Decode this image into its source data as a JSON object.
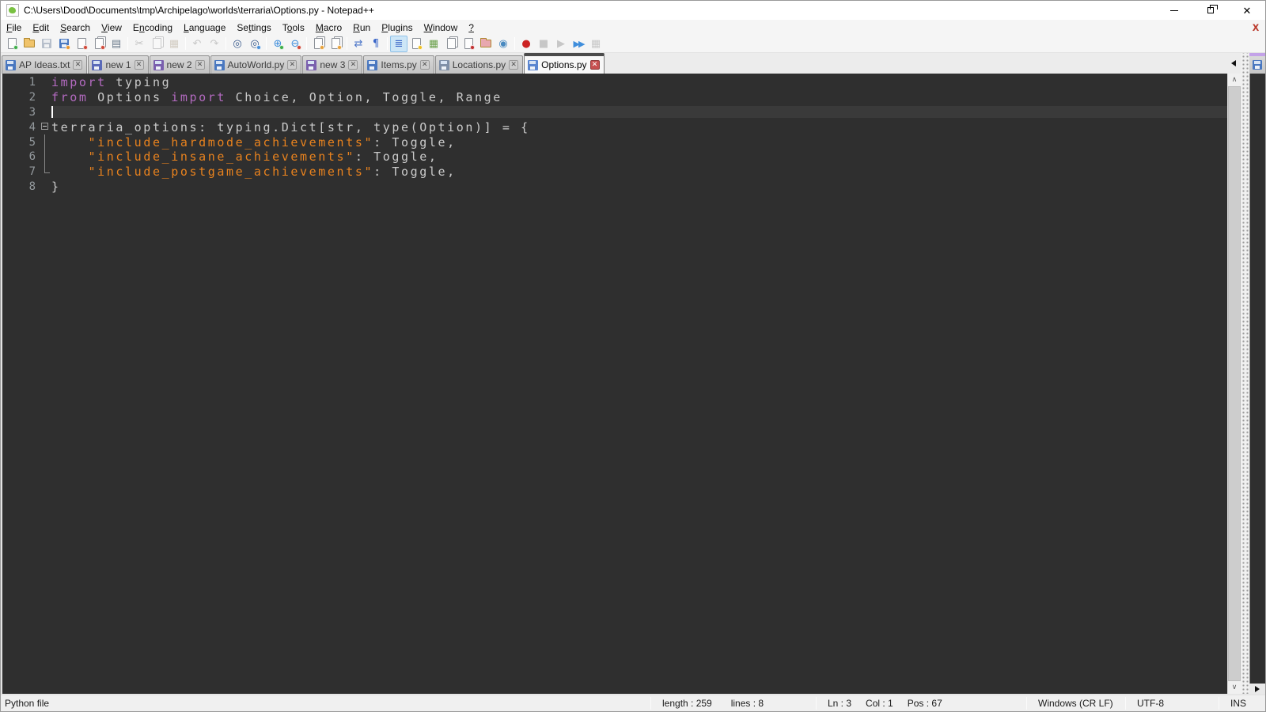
{
  "window": {
    "title": "C:\\Users\\Dood\\Documents\\tmp\\Archipelago\\worlds\\terraria\\Options.py - Notepad++",
    "close_document_label": "X"
  },
  "menu": {
    "items": [
      {
        "label": "File",
        "u": 0
      },
      {
        "label": "Edit",
        "u": 0
      },
      {
        "label": "Search",
        "u": 0
      },
      {
        "label": "View",
        "u": 0
      },
      {
        "label": "Encoding",
        "u": 1
      },
      {
        "label": "Language",
        "u": 0
      },
      {
        "label": "Settings",
        "u": 2
      },
      {
        "label": "Tools",
        "u": 1
      },
      {
        "label": "Macro",
        "u": 0
      },
      {
        "label": "Run",
        "u": 0
      },
      {
        "label": "Plugins",
        "u": 0
      },
      {
        "label": "Window",
        "u": 0
      },
      {
        "label": "?",
        "u": 0
      }
    ]
  },
  "toolbar": {
    "groups": [
      [
        {
          "name": "new-file-button",
          "kind": "page",
          "badge": "#3fae49"
        },
        {
          "name": "open-file-button",
          "kind": "folder",
          "color": "#f0c36a"
        },
        {
          "name": "save-button",
          "kind": "floppy",
          "disabled": true
        },
        {
          "name": "save-all-button",
          "kind": "floppy",
          "badge": "#e8962e"
        },
        {
          "name": "close-file-button",
          "kind": "page",
          "badge": "#d04a3a"
        },
        {
          "name": "close-all-button",
          "kind": "page2",
          "badge": "#d04a3a"
        },
        {
          "name": "print-button",
          "kind": "glyph",
          "glyph": "▤",
          "color": "#6a7a8a"
        }
      ],
      [
        {
          "name": "cut-button",
          "kind": "glyph",
          "glyph": "✂",
          "color": "#777777",
          "disabled": true
        },
        {
          "name": "copy-button",
          "kind": "page2",
          "disabled": true
        },
        {
          "name": "paste-button",
          "kind": "glyph",
          "glyph": "▦",
          "color": "#b8935a",
          "disabled": true
        }
      ],
      [
        {
          "name": "undo-button",
          "kind": "glyph",
          "glyph": "↶",
          "color": "#8a8a8a",
          "disabled": true
        },
        {
          "name": "redo-button",
          "kind": "glyph",
          "glyph": "↷",
          "color": "#8a8a8a",
          "disabled": true
        }
      ],
      [
        {
          "name": "find-button",
          "kind": "glyph",
          "glyph": "◎",
          "color": "#3a5a8c"
        },
        {
          "name": "replace-button",
          "kind": "glyph",
          "glyph": "◎",
          "color": "#3a5a8c",
          "badge": "#4a90d9"
        }
      ],
      [
        {
          "name": "zoom-in-button",
          "kind": "glyph",
          "glyph": "⊕",
          "color": "#3f8edc",
          "badge": "#3fae49"
        },
        {
          "name": "zoom-out-button",
          "kind": "glyph",
          "glyph": "⊖",
          "color": "#3f8edc",
          "badge": "#d04a3a"
        }
      ],
      [
        {
          "name": "sync-vertical-scrolling-button",
          "kind": "page2",
          "badge": "#e8a23a"
        },
        {
          "name": "sync-horizontal-scrolling-button",
          "kind": "page2",
          "badge": "#e8a23a"
        }
      ],
      [
        {
          "name": "word-wrap-button",
          "kind": "glyph",
          "glyph": "⇄",
          "color": "#4a74c8"
        },
        {
          "name": "show-all-characters-button",
          "kind": "glyph",
          "glyph": "¶",
          "color": "#3a66c8"
        }
      ],
      [
        {
          "name": "show-indent-guide-button",
          "kind": "glyph",
          "glyph": "≣",
          "color": "#3a66c8",
          "pressed": true
        },
        {
          "name": "define-language-button",
          "kind": "page",
          "badge": "#f0c020"
        },
        {
          "name": "document-map-button",
          "kind": "glyph",
          "glyph": "▦",
          "color": "#6aa04a"
        },
        {
          "name": "document-list-button",
          "kind": "page2"
        },
        {
          "name": "user-defined-language-button",
          "kind": "page",
          "badge": "#c03030"
        },
        {
          "name": "folder-as-workspace-button",
          "kind": "folder",
          "color": "#e8a8b0"
        },
        {
          "name": "monitoring-button",
          "kind": "glyph",
          "glyph": "◉",
          "color": "#4a8ac0"
        }
      ],
      [
        {
          "name": "macro-record-button",
          "kind": "glyph",
          "glyph": "●",
          "color": "#cc2222"
        },
        {
          "name": "macro-stop-button",
          "kind": "glyph",
          "glyph": "■",
          "color": "#8a8a8a",
          "disabled": true
        },
        {
          "name": "macro-play-button",
          "kind": "glyph",
          "glyph": "▶",
          "color": "#8a8a8a",
          "disabled": true
        },
        {
          "name": "macro-run-multiple-button",
          "kind": "glyph",
          "glyph": "▶▶",
          "color": "#3f8edc",
          "small": true
        },
        {
          "name": "macro-save-button",
          "kind": "glyph",
          "glyph": "▦",
          "color": "#8a8a8a",
          "disabled": true
        }
      ]
    ]
  },
  "tabs": [
    {
      "label": "AP Ideas.txt",
      "active": false,
      "icon_color": "#4a78c0"
    },
    {
      "label": "new 1",
      "active": false,
      "icon_color": "#5a6ab8"
    },
    {
      "label": "new 2",
      "active": false,
      "icon_color": "#7a5fae"
    },
    {
      "label": "AutoWorld.py",
      "active": false,
      "icon_color": "#4a78c0"
    },
    {
      "label": "new 3",
      "active": false,
      "icon_color": "#7a5fae"
    },
    {
      "label": "Items.py",
      "active": false,
      "icon_color": "#4a78c0"
    },
    {
      "label": "Locations.py",
      "active": false,
      "icon_color": "#8090a8"
    },
    {
      "label": "Options.py",
      "active": true,
      "icon_color": "#5b86d0"
    }
  ],
  "editor": {
    "colors": {
      "background": "#2f2f2f",
      "current_line": "#3a3a3a",
      "text": "#cacaca",
      "keyword": "#b36ac0",
      "string": "#e8821e",
      "line_number": "#949a9e"
    },
    "cursor": {
      "line": 3,
      "col": 1
    },
    "lines": [
      {
        "n": 1,
        "fold": "",
        "tokens": [
          {
            "t": "kw",
            "v": "import"
          },
          {
            "t": "p",
            "v": " typing"
          }
        ]
      },
      {
        "n": 2,
        "fold": "",
        "tokens": [
          {
            "t": "kw",
            "v": "from"
          },
          {
            "t": "p",
            "v": " Options "
          },
          {
            "t": "kw",
            "v": "import"
          },
          {
            "t": "p",
            "v": " Choice, Option, Toggle, Range"
          }
        ]
      },
      {
        "n": 3,
        "fold": "",
        "tokens": []
      },
      {
        "n": 4,
        "fold": "start",
        "tokens": [
          {
            "t": "p",
            "v": "terraria_options: typing.Dict[str, type(Option)] = {"
          }
        ]
      },
      {
        "n": 5,
        "fold": "line",
        "tokens": [
          {
            "t": "p",
            "v": "    "
          },
          {
            "t": "str",
            "v": "\"include_hardmode_achievements\""
          },
          {
            "t": "p",
            "v": ": Toggle,"
          }
        ]
      },
      {
        "n": 6,
        "fold": "line",
        "tokens": [
          {
            "t": "p",
            "v": "    "
          },
          {
            "t": "str",
            "v": "\"include_insane_achievements\""
          },
          {
            "t": "p",
            "v": ": Toggle,"
          }
        ]
      },
      {
        "n": 7,
        "fold": "end",
        "tokens": [
          {
            "t": "p",
            "v": "    "
          },
          {
            "t": "str",
            "v": "\"include_postgame_achievements\""
          },
          {
            "t": "p",
            "v": ": Toggle,"
          }
        ]
      },
      {
        "n": 8,
        "fold": "",
        "tokens": [
          {
            "t": "p",
            "v": "}"
          }
        ]
      }
    ]
  },
  "statusbar": {
    "doc_type": "Python file",
    "length": "length : 259",
    "lines": "lines : 8",
    "ln": "Ln : 3",
    "col": "Col : 1",
    "pos": "Pos : 67",
    "eol": "Windows (CR LF)",
    "encoding": "UTF-8",
    "insert_mode": "INS"
  }
}
